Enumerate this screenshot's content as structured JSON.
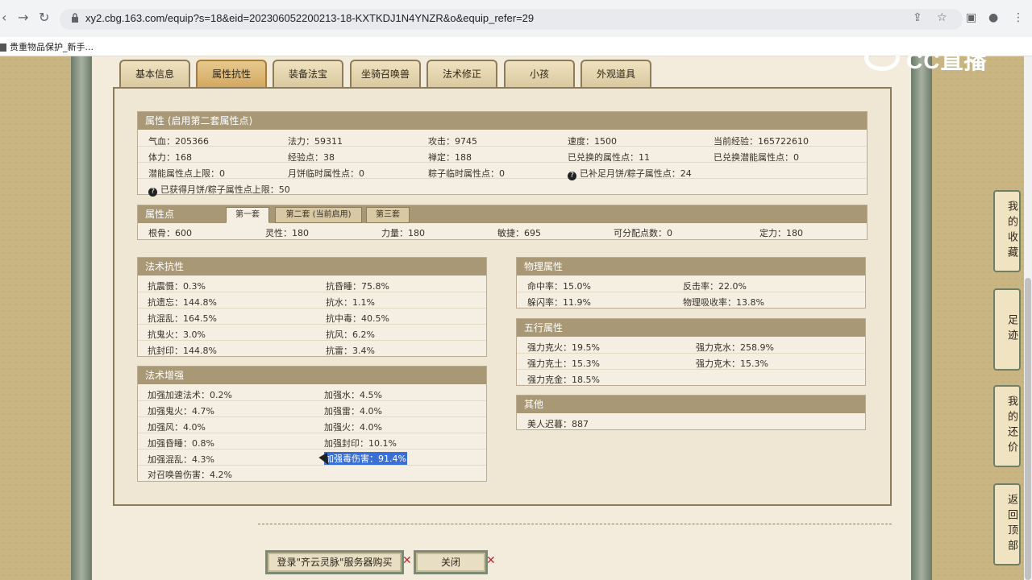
{
  "browser": {
    "url": "xy2.cbg.163.com/equip?s=18&eid=202306052200213-18-KXTKDJ1N4YNZR&o&equip_refer=29",
    "bookmark": "贵重物品保护_新手..."
  },
  "logo_text": "CC直播",
  "tabs": [
    "基本信息",
    "属性抗性",
    "装备法宝",
    "坐骑召唤兽",
    "法术修正",
    "小孩",
    "外观道具"
  ],
  "attributes": {
    "header": "属性 (启用第二套属性点)",
    "rows": [
      [
        "气血：205366",
        "法力：59311",
        "攻击：9745",
        "速度：1500",
        "当前经验：165722610"
      ],
      [
        "体力：168",
        "经验点：38",
        "禅定：188",
        "已兑换的属性点：11",
        "已兑换潜能属性点：0"
      ],
      [
        "潜能属性点上限：0",
        "月饼临时属性点：0",
        "粽子临时属性点：0",
        "已补足月饼/粽子属性点：24"
      ],
      [
        "已获得月饼/粽子属性点上限：50"
      ]
    ]
  },
  "points": {
    "header": "属性点",
    "subtabs": [
      "第一套",
      "第二套 (当前启用)",
      "第三套"
    ],
    "values": [
      "根骨：600",
      "灵性：180",
      "力量：180",
      "敏捷：695",
      "可分配点数：0",
      "定力：180"
    ]
  },
  "magic_resist": {
    "header": "法术抗性",
    "rows": [
      [
        "抗震慑：0.3%",
        "抗昏睡：75.8%"
      ],
      [
        "抗遗忘：144.8%",
        "抗水：1.1%"
      ],
      [
        "抗混乱：164.5%",
        "抗中毒：40.5%"
      ],
      [
        "抗鬼火：3.0%",
        "抗风：6.2%"
      ],
      [
        "抗封印：144.8%",
        "抗雷：3.4%"
      ]
    ]
  },
  "magic_boost": {
    "header": "法术增强",
    "rows": [
      [
        "加强加速法术：0.2%",
        "加强水：4.5%"
      ],
      [
        "加强鬼火：4.7%",
        "加强雷：4.0%"
      ],
      [
        "加强风：4.0%",
        "加强火：4.0%"
      ],
      [
        "加强昏睡：0.8%",
        "加强封印：10.1%"
      ],
      [
        "加强混乱：4.3%",
        "加强毒伤害：91.4%"
      ],
      [
        "对召唤兽伤害：4.2%",
        ""
      ]
    ]
  },
  "physical": {
    "header": "物理属性",
    "rows": [
      [
        "命中率：15.0%",
        "反击率：22.0%"
      ],
      [
        "躲闪率：11.9%",
        "物理吸收率：13.8%"
      ]
    ]
  },
  "five_elements": {
    "header": "五行属性",
    "rows": [
      [
        "强力克火：19.5%",
        "强力克水：258.9%"
      ],
      [
        "强力克土：15.3%",
        "强力克木：15.3%"
      ],
      [
        "强力克金：18.5%",
        ""
      ]
    ]
  },
  "other": {
    "header": "其他",
    "rows": [
      [
        "美人迟暮：887"
      ]
    ]
  },
  "buttons": {
    "login": "登录\"齐云灵脉\"服务器购买",
    "close": "关闭"
  },
  "side_buttons": [
    "我的收藏",
    "足迹",
    "我的还价",
    "返回顶部"
  ],
  "colors": {
    "panel_header": "#a89875",
    "highlight": "#3a6fd8",
    "page_bg": "#c9b582"
  }
}
